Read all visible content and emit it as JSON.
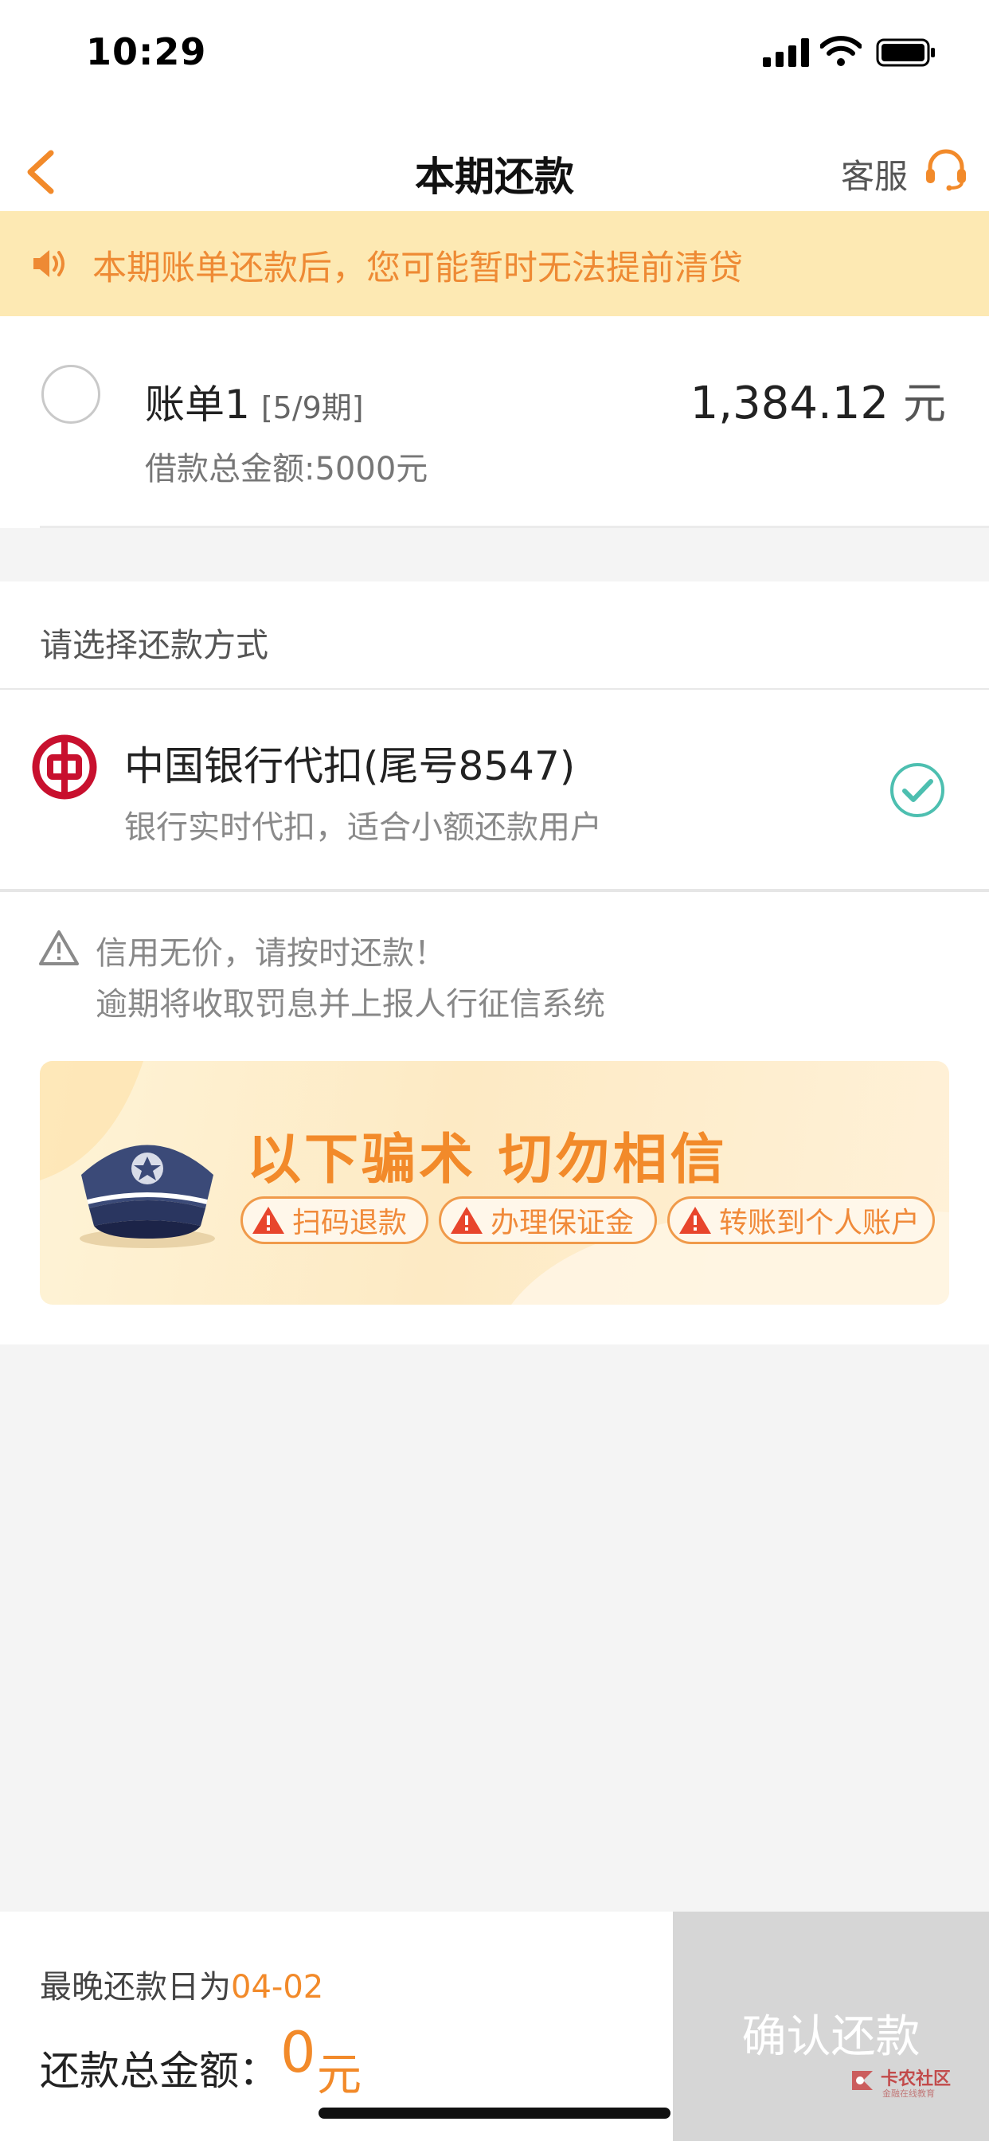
{
  "status_bar": {
    "time": "10:29"
  },
  "nav": {
    "title": "本期还款",
    "service_label": "客服"
  },
  "notice": {
    "text": "本期账单还款后，您可能暂时无法提前清贷"
  },
  "bill": {
    "name": "账单1",
    "period": "[5/9期]",
    "amount": "1,384.12",
    "unit": "元",
    "total_loan": "借款总金额:5000元",
    "selected": false
  },
  "payment_method": {
    "section_label": "请选择还款方式",
    "bank_name": "中国银行代扣(尾号8547)",
    "description": "银行实时代扣，适合小额还款用户",
    "selected": true
  },
  "warning": {
    "line1": "信用无价，请按时还款！",
    "line2": "逾期将收取罚息并上报人行征信系统"
  },
  "banner": {
    "title": "以下骗术 切勿相信",
    "tags": [
      "扫码退款",
      "办理保证金",
      "转账到个人账户"
    ]
  },
  "footer": {
    "deadline_prefix": "最晚还款日为",
    "deadline_date": "04-02",
    "total_label": "还款总金额：",
    "total_amount": "0",
    "total_unit": "元",
    "confirm_label": "确认还款",
    "watermark": "卡农社区",
    "watermark_sub": "金融在线教育"
  },
  "colors": {
    "accent": "#f28a2a",
    "notice_bg": "#fde9b3",
    "check": "#4dbfb0",
    "boc_red": "#c8102e",
    "disabled_button": "#d6d6d6"
  }
}
